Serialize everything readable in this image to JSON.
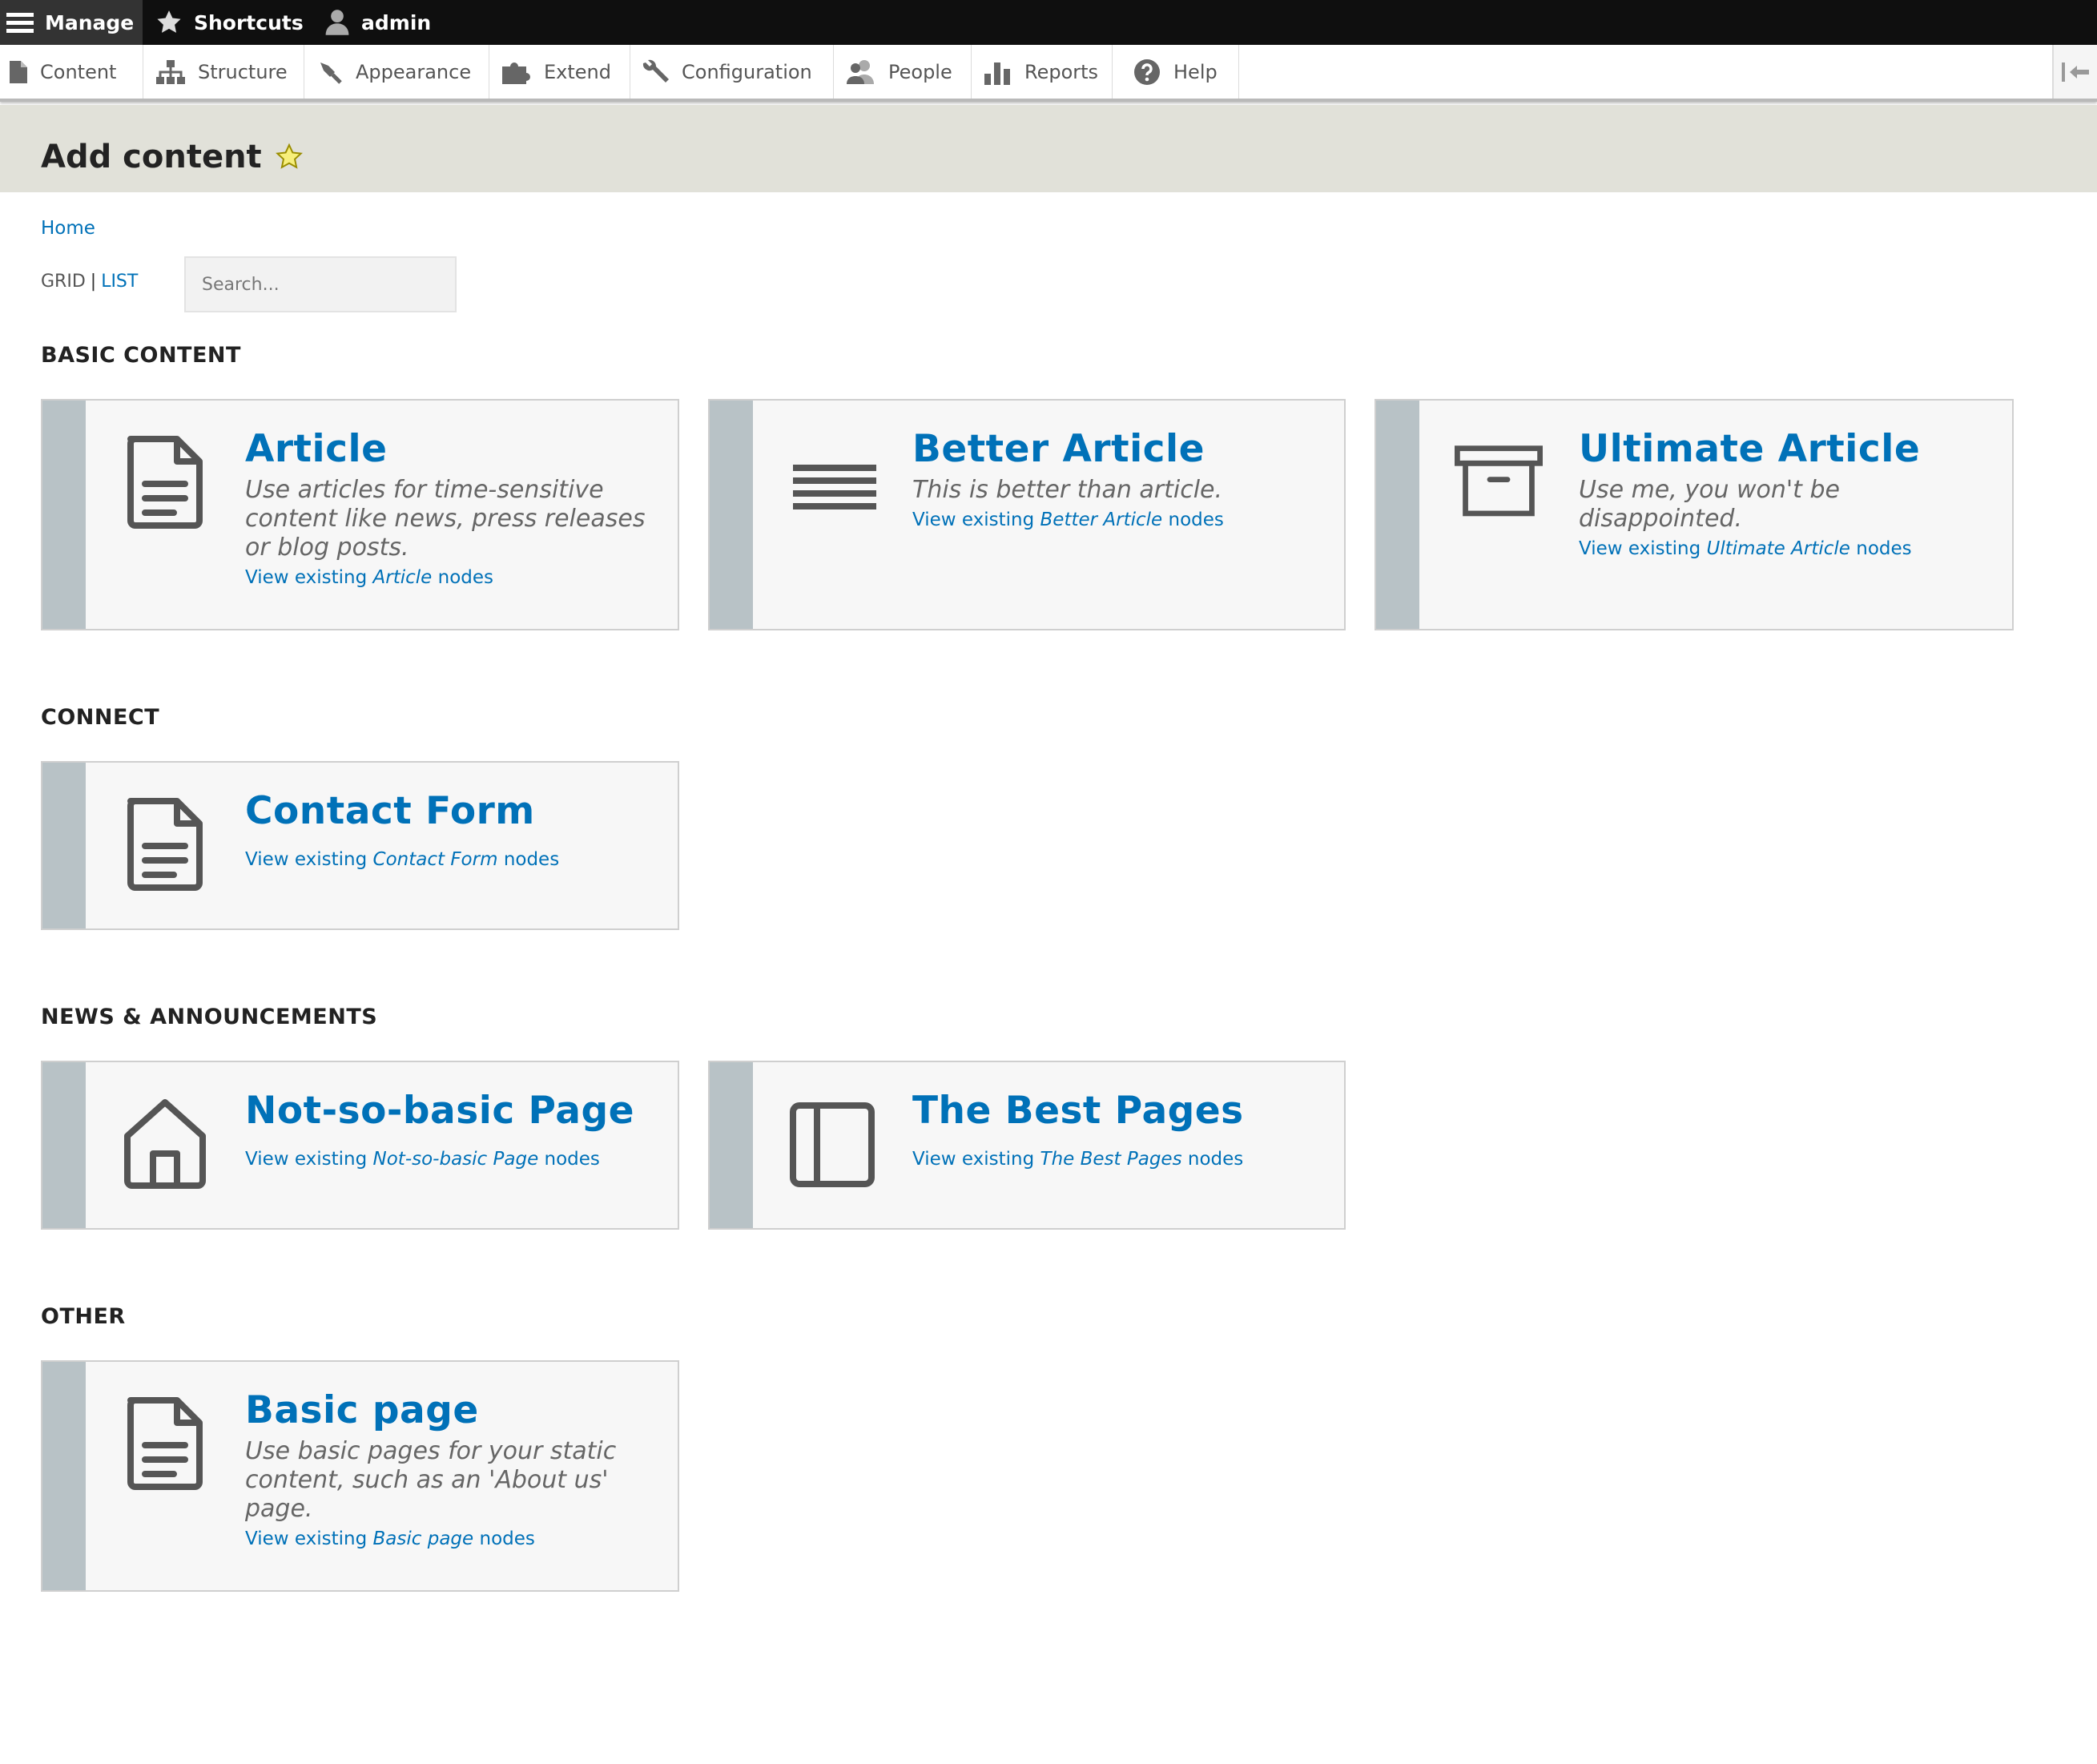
{
  "toolbar": {
    "manage": "Manage",
    "shortcuts": "Shortcuts",
    "user": "admin"
  },
  "tray": {
    "items": [
      {
        "label": "Content",
        "icon": "file-icon"
      },
      {
        "label": "Structure",
        "icon": "sitemap-icon"
      },
      {
        "label": "Appearance",
        "icon": "paintbrush-icon"
      },
      {
        "label": "Extend",
        "icon": "puzzle-icon"
      },
      {
        "label": "Configuration",
        "icon": "wrench-icon"
      },
      {
        "label": "People",
        "icon": "people-icon"
      },
      {
        "label": "Reports",
        "icon": "bar-chart-icon"
      },
      {
        "label": "Help",
        "icon": "help-icon"
      }
    ]
  },
  "page": {
    "title": "Add content",
    "breadcrumb": "Home"
  },
  "view_switch": {
    "grid": "GRID",
    "separator": "|",
    "list": "LIST"
  },
  "search": {
    "placeholder": "Search..."
  },
  "sections": [
    {
      "heading": "BASIC CONTENT",
      "cards": [
        {
          "title": "Article",
          "description": "Use articles for time-sensitive content like news, press releases or blog posts.",
          "view_prefix": "View existing",
          "view_type": "Article",
          "view_suffix": "nodes",
          "icon": "document-icon"
        },
        {
          "title": "Better Article",
          "description": "This is better than article.",
          "view_prefix": "View existing",
          "view_type": "Better Article",
          "view_suffix": "nodes",
          "icon": "menu-lines-icon"
        },
        {
          "title": "Ultimate Article",
          "description": "Use me, you won't be disappointed.",
          "view_prefix": "View existing",
          "view_type": "Ultimate Article",
          "view_suffix": "nodes",
          "icon": "archive-box-icon"
        }
      ]
    },
    {
      "heading": "CONNECT",
      "cards": [
        {
          "title": "Contact Form",
          "description": "",
          "view_prefix": "View existing",
          "view_type": "Contact Form",
          "view_suffix": "nodes",
          "icon": "document-icon"
        }
      ]
    },
    {
      "heading": "NEWS & ANNOUNCEMENTS",
      "cards": [
        {
          "title": "Not-so-basic Page",
          "description": "",
          "view_prefix": "View existing",
          "view_type": "Not-so-basic Page",
          "view_suffix": "nodes",
          "icon": "house-icon"
        },
        {
          "title": "The Best Pages",
          "description": "",
          "view_prefix": "View existing",
          "view_type": "The Best Pages",
          "view_suffix": "nodes",
          "icon": "sidebar-layout-icon"
        }
      ]
    },
    {
      "heading": "OTHER",
      "cards": [
        {
          "title": "Basic page",
          "description": "Use basic pages for your static content, such as an 'About us' page.",
          "view_prefix": "View existing",
          "view_type": "Basic page",
          "view_suffix": "nodes",
          "icon": "document-icon"
        }
      ]
    }
  ],
  "colors": {
    "link": "#0071b8",
    "toolbar": "#0f0f0f",
    "header_band": "#e1e1d9",
    "card_stripe": "#b8c2c6",
    "favorite_star": "#f5e642"
  }
}
